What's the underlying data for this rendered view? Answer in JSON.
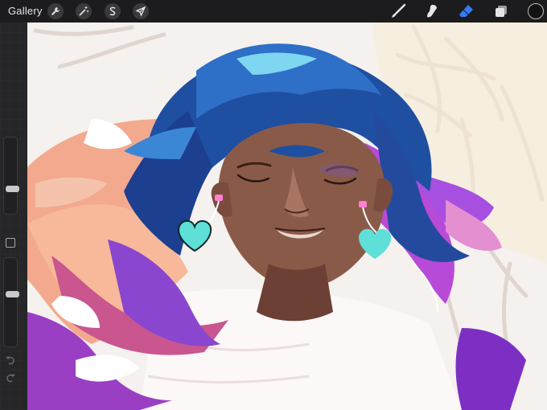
{
  "toolbar": {
    "gallery_label": "Gallery",
    "action_icons": [
      "wrench-icon",
      "magic-wand-icon",
      "selection-s-icon",
      "arrow-cursor-icon"
    ],
    "tool_icons": [
      "brush-icon",
      "smudge-icon",
      "eraser-icon",
      "layers-icon"
    ],
    "active_tool": "eraser-icon",
    "active_color": "#121212",
    "accent": "#2f7cf6"
  },
  "sidebar": {
    "brush_size_level": 0.3,
    "opacity_level": 0.4,
    "icons": [
      "modify-square-icon",
      "undo-icon",
      "redo-icon"
    ]
  },
  "canvas": {
    "subject": "illustration-of-sleeping-girl-with-flowing-blue-purple-hair-and-heart-earrings"
  }
}
